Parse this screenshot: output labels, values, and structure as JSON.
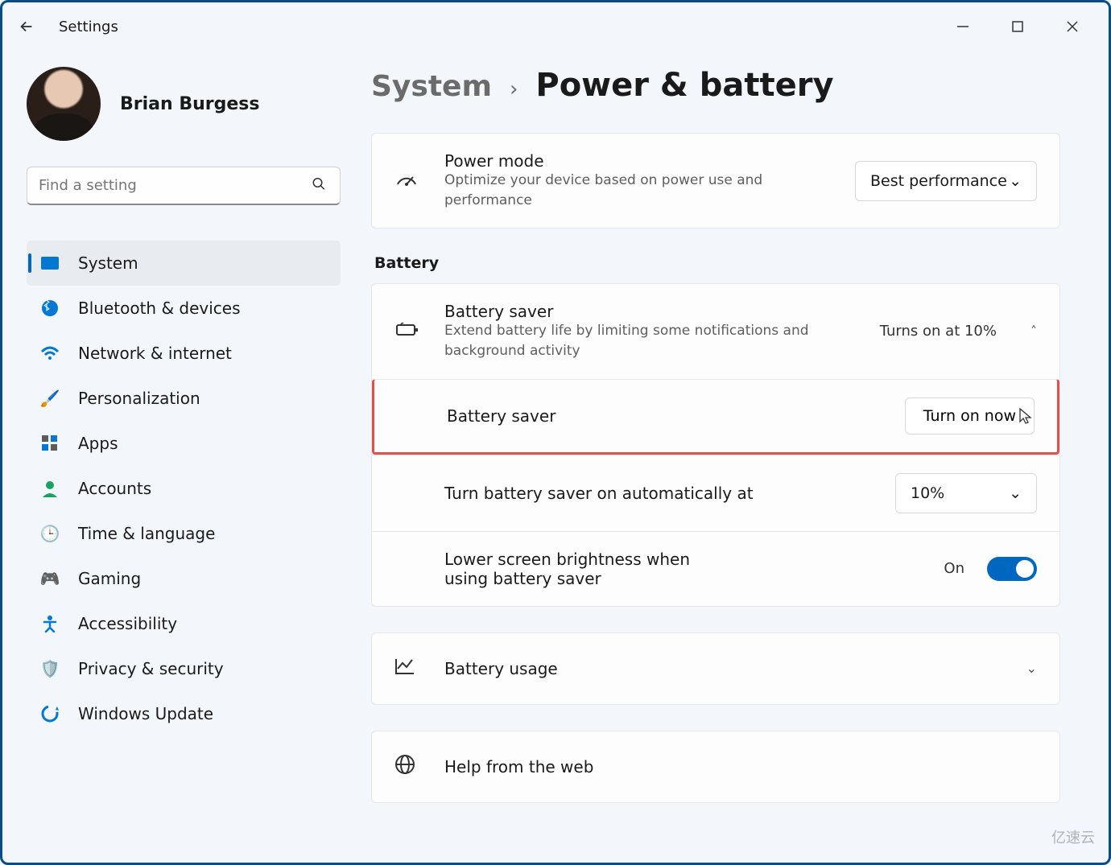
{
  "window": {
    "app_title": "Settings"
  },
  "user": {
    "name": "Brian Burgess"
  },
  "search": {
    "placeholder": "Find a setting"
  },
  "sidebar": {
    "items": [
      {
        "label": "System",
        "icon": "🖥️",
        "active": true
      },
      {
        "label": "Bluetooth & devices",
        "icon": "bt"
      },
      {
        "label": "Network & internet",
        "icon": "wifi"
      },
      {
        "label": "Personalization",
        "icon": "🖌️"
      },
      {
        "label": "Apps",
        "icon": "apps"
      },
      {
        "label": "Accounts",
        "icon": "👤"
      },
      {
        "label": "Time & language",
        "icon": "🌐"
      },
      {
        "label": "Gaming",
        "icon": "🎮"
      },
      {
        "label": "Accessibility",
        "icon": "acc"
      },
      {
        "label": "Privacy & security",
        "icon": "🛡️"
      },
      {
        "label": "Windows Update",
        "icon": "🔄"
      }
    ]
  },
  "breadcrumb": {
    "parent": "System",
    "current": "Power & battery"
  },
  "power_mode": {
    "title": "Power mode",
    "desc": "Optimize your device based on power use and performance",
    "selected": "Best performance"
  },
  "battery": {
    "heading": "Battery",
    "saver": {
      "title": "Battery saver",
      "desc": "Extend battery life by limiting some notifications and background activity",
      "status": "Turns on at 10%"
    },
    "saver_action": {
      "label": "Battery saver",
      "button": "Turn on now"
    },
    "auto": {
      "label": "Turn battery saver on automatically at",
      "value": "10%"
    },
    "brightness": {
      "label": "Lower screen brightness when using battery saver",
      "state": "On"
    },
    "usage": {
      "label": "Battery usage"
    }
  },
  "help": {
    "label": "Help from the web"
  },
  "watermark": "亿速云"
}
